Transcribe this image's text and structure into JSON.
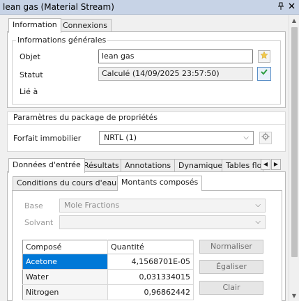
{
  "window": {
    "title": "lean gas (Material Stream)",
    "pin_icon": "pin-icon",
    "close_icon": "close-icon"
  },
  "top_tabs": [
    {
      "label": "Information",
      "active": true
    },
    {
      "label": "Connexions",
      "active": false
    }
  ],
  "general_info": {
    "legend": "Informations générales",
    "object_label": "Objet",
    "object_value": "lean gas",
    "status_label": "Statut",
    "status_value": "Calculé (14/09/2025 23:57:50)",
    "linked_label": "Lié à"
  },
  "property_package": {
    "legend": "Paramètres du package de propriétés",
    "label": "Forfait immobilier",
    "selected": "NRTL (1)"
  },
  "data_tabs": [
    {
      "label": "Données d'entrée",
      "active": true
    },
    {
      "label": "Résultats",
      "active": false
    },
    {
      "label": "Annotations",
      "active": false
    },
    {
      "label": "Dynamique",
      "active": false
    },
    {
      "label": "Tables flo",
      "active": false
    }
  ],
  "sub_tabs": [
    {
      "label": "Conditions du cours d'eau",
      "active": false
    },
    {
      "label": "Montants composés",
      "active": true
    }
  ],
  "composition": {
    "base_label": "Base",
    "base_value": "Mole Fractions",
    "solvent_label": "Solvant",
    "solvent_value": "",
    "columns": [
      "Composé",
      "Quantité"
    ],
    "rows": [
      {
        "name": "Acetone",
        "qty": "4,1568701E-05",
        "selected": true
      },
      {
        "name": "Water",
        "qty": "0,031334015",
        "selected": false
      },
      {
        "name": "Nitrogen",
        "qty": "0,96862442",
        "selected": false
      }
    ],
    "buttons": {
      "normalize": "Normaliser",
      "equalize": "Égaliser",
      "clear": "Clair"
    }
  },
  "colors": {
    "selection": "#0078d7",
    "titlebar": "#c7d3e6"
  }
}
